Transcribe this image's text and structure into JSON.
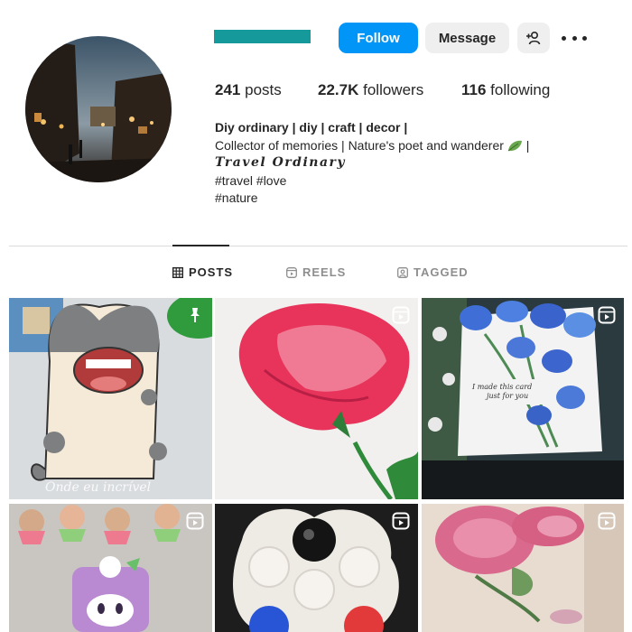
{
  "colors": {
    "username_bar": "#16999b",
    "follow_button": "#0095f6",
    "secondary_button": "#efefef",
    "divider": "#dbdbdb",
    "text": "#262626",
    "muted": "#8e8e8e"
  },
  "header": {
    "follow_label": "Follow",
    "message_label": "Message",
    "add_user_icon": "person-plus-icon",
    "more_icon": "more-options-icon"
  },
  "stats": {
    "posts_count": "241",
    "posts_label": "posts",
    "followers_count": "22.7K",
    "followers_label": "followers",
    "following_count": "116",
    "following_label": "following"
  },
  "bio": {
    "name": "Diy ordinary | diy | craft | decor |",
    "line1": "Collector of memories | Nature's poet and wanderer",
    "line1_suffix": "|",
    "script_line": "Travel Ordinary",
    "hashtags1": "#travel #love",
    "hashtags2": "#nature"
  },
  "tabs": [
    {
      "label": "POSTS",
      "icon": "grid-icon",
      "active": true
    },
    {
      "label": "REELS",
      "icon": "reels-icon",
      "active": false
    },
    {
      "label": "TAGGED",
      "icon": "tagged-icon",
      "active": false
    }
  ],
  "grid": {
    "tile1_caption": "Onde eu incrível",
    "tile3_card_text_line1": "I made this card",
    "tile3_card_text_line2": "just for you"
  }
}
